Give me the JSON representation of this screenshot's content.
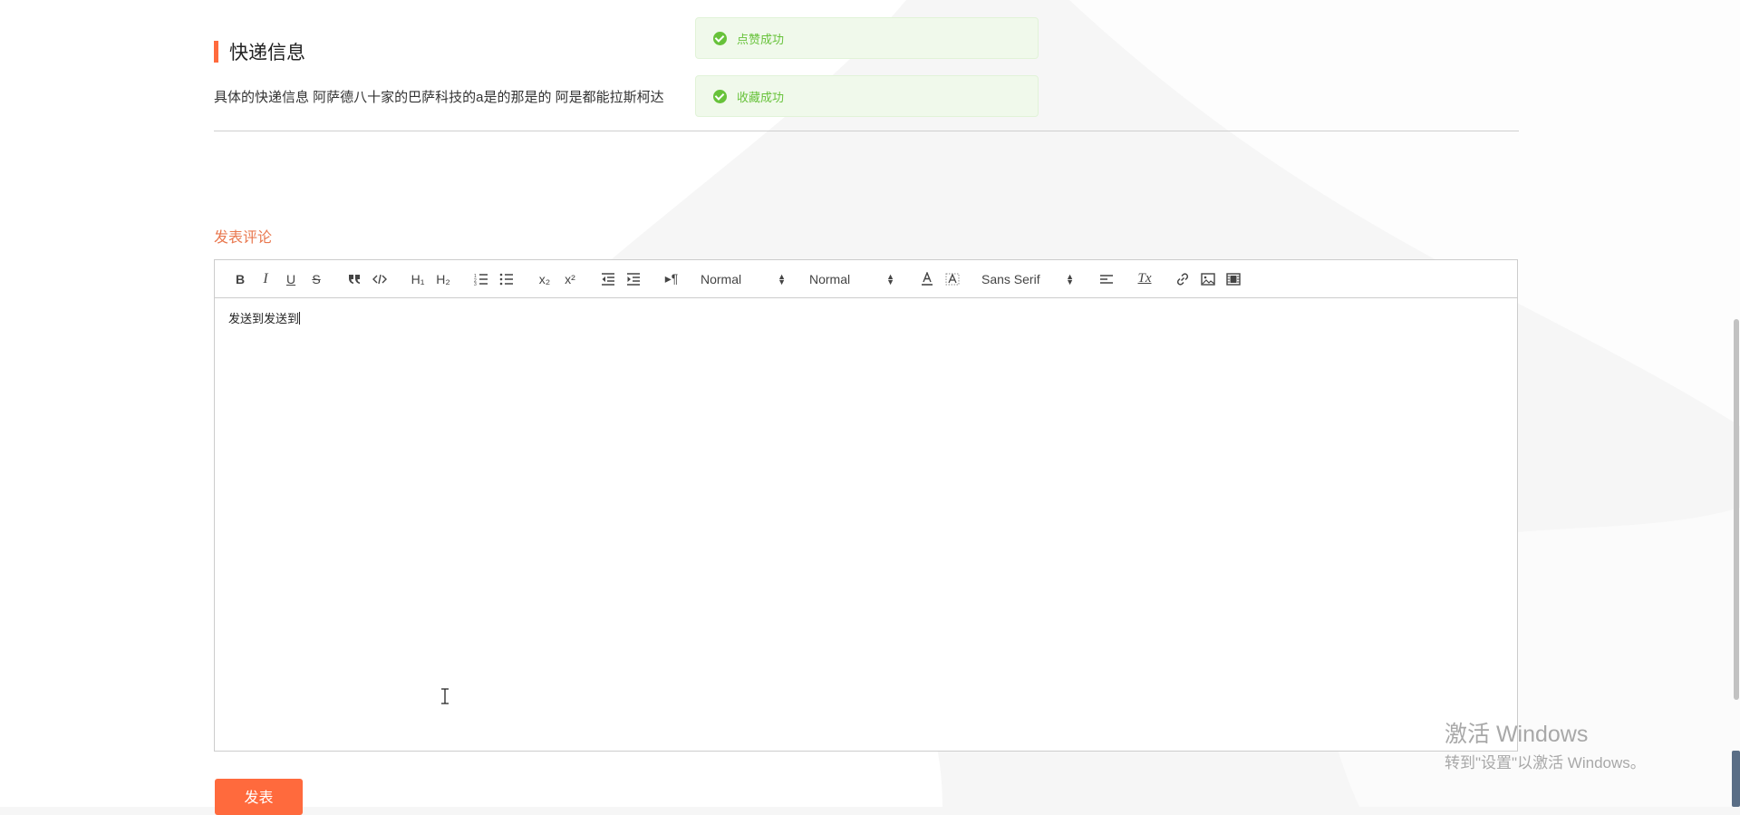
{
  "section": {
    "title": "快递信息",
    "description": "具体的快递信息 阿萨德八十家的巴萨科技的a是的那是的 阿是都能拉斯柯达"
  },
  "toasts": [
    {
      "text": "点赞成功",
      "status": "success"
    },
    {
      "text": "收藏成功",
      "status": "success"
    }
  ],
  "comment": {
    "label": "发表评论",
    "content": "发送到发送到",
    "submit_label": "发表"
  },
  "toolbar": {
    "bold": "B",
    "italic": "I",
    "underline": "U",
    "strike": "S",
    "h1": "H₁",
    "h2": "H₂",
    "subscript": "x₂",
    "superscript": "x²",
    "direction": "▸¶",
    "size_picker": "Normal",
    "header_picker": "Normal",
    "font_picker": "Sans Serif",
    "clean": "Tx"
  },
  "watermark": {
    "title": "激活 Windows",
    "subtitle": "转到\"设置\"以激活 Windows。"
  },
  "colors": {
    "accent": "#ff6a3d",
    "comment_label": "#e9784f",
    "success": "#67c23a",
    "success_bg": "#f0f9eb"
  }
}
